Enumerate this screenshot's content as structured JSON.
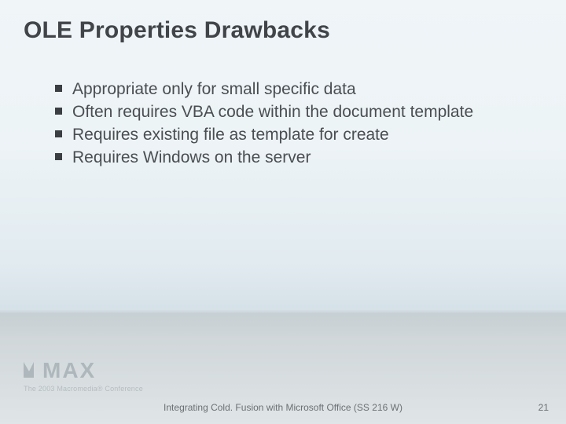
{
  "title": "OLE Properties Drawbacks",
  "bullets": [
    "Appropriate only for small specific data",
    "Often requires VBA code within the document template",
    "Requires existing file as template for create",
    "Requires Windows on the server"
  ],
  "logo": {
    "text": "MAX",
    "subtitle": "The 2003 Macromedia® Conference"
  },
  "footer": {
    "title": "Integrating Cold. Fusion with Microsoft Office (SS 216 W)",
    "page": "21"
  }
}
